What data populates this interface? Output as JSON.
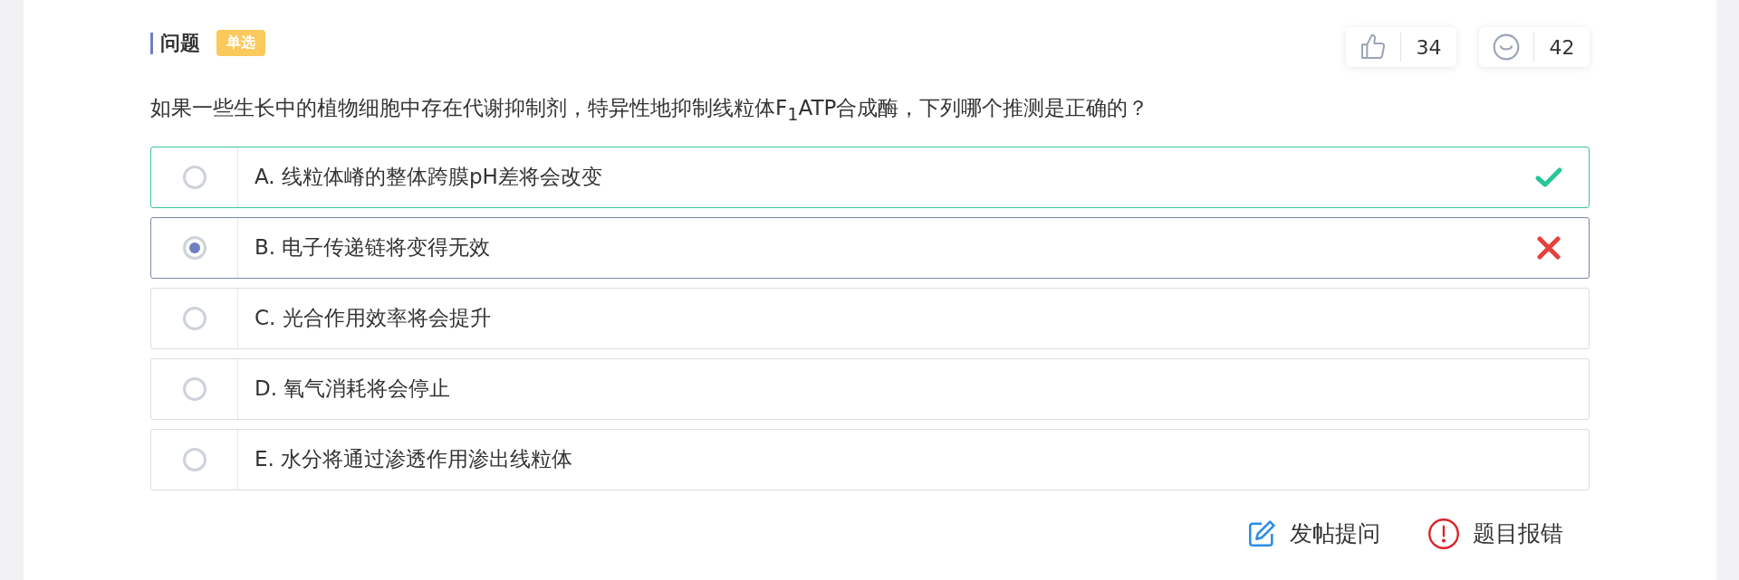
{
  "header": {
    "title": "问题",
    "badge": "单选"
  },
  "reactions": [
    {
      "kind": "like",
      "count": "34"
    },
    {
      "kind": "smile",
      "count": "42"
    }
  ],
  "question": "如果一些生长中的植物细胞中存在代谢抑制剂，特异性地抑制线粒体F$_{1}$ATP合成酶，下列哪个推测是正确的？",
  "options": [
    {
      "label": "A. 线粒体嵴的整体跨膜pH差将会改变",
      "selected": false,
      "kind": "correct"
    },
    {
      "label": "B. 电子传递链将变得无效",
      "selected": true,
      "kind": "wrong"
    },
    {
      "label": "C. 光合作用效率将会提升",
      "selected": false,
      "kind": "plain"
    },
    {
      "label": "D. 氧气消耗将会停止",
      "selected": false,
      "kind": "plain"
    },
    {
      "label": "E. 水分将通过渗透作用渗出线粒体",
      "selected": false,
      "kind": "plain"
    }
  ],
  "actions": [
    {
      "kind": "post",
      "label": "发帖提问"
    },
    {
      "kind": "report",
      "label": "题目报错"
    }
  ]
}
